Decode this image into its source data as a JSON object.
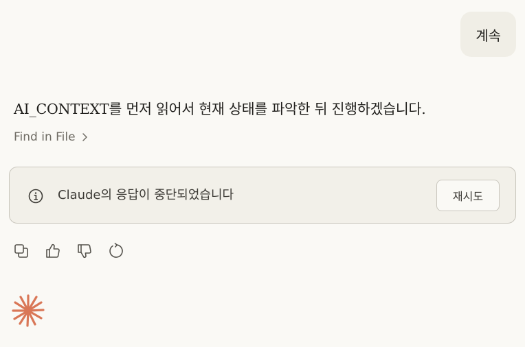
{
  "user_message": {
    "text": "계속"
  },
  "assistant": {
    "message": "AI_CONTEXT를 먼저 읽어서 현재 상태를 파악한 뒤 진행하겠습니다.",
    "tool_call": {
      "label": "Find in File",
      "icon": "chevron-right-icon"
    },
    "error": {
      "icon": "info-icon",
      "text": "Claude의 응답이 중단되었습니다",
      "retry_label": "재시도"
    },
    "actions": [
      {
        "name": "copy",
        "icon": "copy-icon"
      },
      {
        "name": "thumbs-up",
        "icon": "thumbs-up-icon"
      },
      {
        "name": "thumbs-down",
        "icon": "thumbs-down-icon"
      },
      {
        "name": "retry",
        "icon": "refresh-icon"
      }
    ]
  },
  "colors": {
    "background": "#faf9f5",
    "user_bubble": "#f0eee6",
    "brand_accent": "#d97757"
  }
}
